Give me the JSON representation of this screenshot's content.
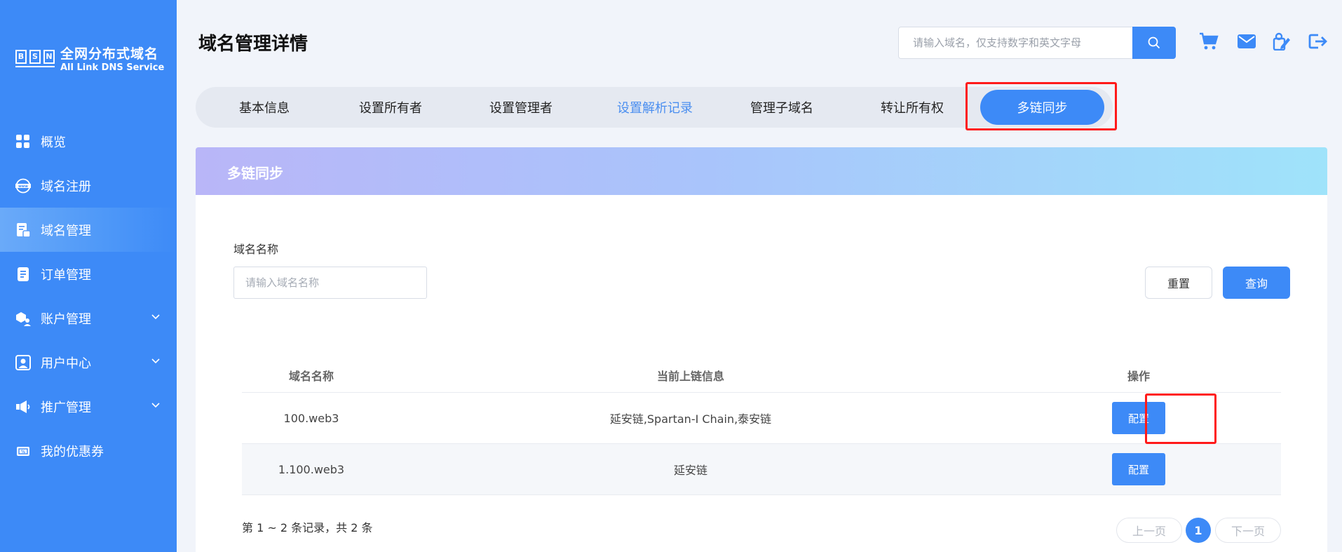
{
  "brand": {
    "letters": [
      "B",
      "S",
      "N"
    ],
    "name_cn": "全网分布式域名",
    "name_en": "All Link DNS Service"
  },
  "sidebar": {
    "items": [
      {
        "label": "概览",
        "icon": "grid-icon",
        "active": false,
        "expandable": false
      },
      {
        "label": "域名注册",
        "icon": "www-icon",
        "active": false,
        "expandable": false
      },
      {
        "label": "域名管理",
        "icon": "domain-doc-icon",
        "active": true,
        "expandable": false
      },
      {
        "label": "订单管理",
        "icon": "order-icon",
        "active": false,
        "expandable": false
      },
      {
        "label": "账户管理",
        "icon": "account-icon",
        "active": false,
        "expandable": true
      },
      {
        "label": "用户中心",
        "icon": "user-icon",
        "active": false,
        "expandable": true
      },
      {
        "label": "推广管理",
        "icon": "megaphone-icon",
        "active": false,
        "expandable": true
      },
      {
        "label": "我的优惠券",
        "icon": "coupon-icon",
        "active": false,
        "expandable": false
      }
    ]
  },
  "header": {
    "title": "域名管理详情",
    "search_placeholder": "请输入域名，仅支持数字和英文字母",
    "icons": [
      "cart-icon",
      "mail-icon",
      "edit-icon",
      "logout-icon"
    ]
  },
  "tabs": [
    {
      "label": "基本信息",
      "state": "normal"
    },
    {
      "label": "设置所有者",
      "state": "normal"
    },
    {
      "label": "设置管理者",
      "state": "normal"
    },
    {
      "label": "设置解析记录",
      "state": "link"
    },
    {
      "label": "管理子域名",
      "state": "normal"
    },
    {
      "label": "转让所有权",
      "state": "normal"
    },
    {
      "label": "多链同步",
      "state": "active"
    }
  ],
  "panel": {
    "title": "多链同步",
    "filter": {
      "label": "域名名称",
      "placeholder": "请输入域名名称",
      "reset_label": "重置",
      "query_label": "查询"
    },
    "table": {
      "columns": [
        "域名名称",
        "当前上链信息",
        "操作"
      ],
      "rows": [
        {
          "domain": "100.web3",
          "chains": "延安链,Spartan-I Chain,泰安链",
          "action": "配置"
        },
        {
          "domain": "1.100.web3",
          "chains": "延安链",
          "action": "配置"
        }
      ]
    },
    "summary": "第 1 ~ 2 条记录，共 2 条",
    "pagination": {
      "prev": "上一页",
      "current": "1",
      "next": "下一页"
    }
  },
  "colors": {
    "primary": "#3d8af7",
    "highlight": "#ff1a1a",
    "tab_link": "#4a8ef0",
    "header_gradient": [
      "#b9b6f8",
      "#a9c4fb",
      "#9fe3fa"
    ]
  }
}
